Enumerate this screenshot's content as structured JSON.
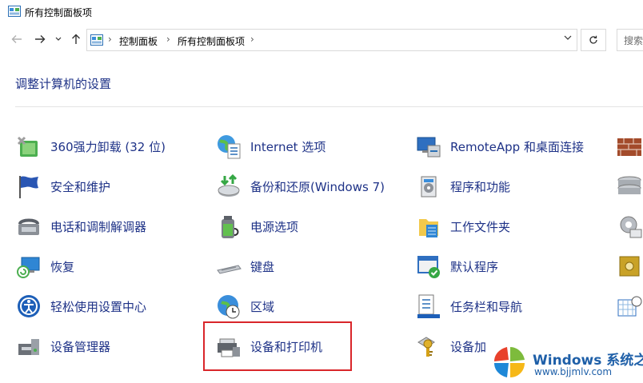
{
  "window": {
    "title": "所有控制面板项"
  },
  "address_bar": {
    "breadcrumbs": [
      "控制面板",
      "所有控制面板项"
    ],
    "search_placeholder": "搜索"
  },
  "heading": "调整计算机的设置",
  "items": [
    {
      "label": "360强力卸载 (32 位)",
      "icon": "uninstall-icon"
    },
    {
      "label": "Internet 选项",
      "icon": "internet-globe-icon"
    },
    {
      "label": "RemoteApp 和桌面连接",
      "icon": "remote-desktop-icon"
    },
    {
      "label": "安全和维护",
      "icon": "security-flag-icon"
    },
    {
      "label": "备份和还原(Windows 7)",
      "icon": "backup-icon"
    },
    {
      "label": "程序和功能",
      "icon": "programs-icon"
    },
    {
      "label": "电话和调制解调器",
      "icon": "phone-modem-icon"
    },
    {
      "label": "电源选项",
      "icon": "power-icon"
    },
    {
      "label": "工作文件夹",
      "icon": "work-folder-icon"
    },
    {
      "label": "恢复",
      "icon": "recovery-icon"
    },
    {
      "label": "键盘",
      "icon": "keyboard-icon"
    },
    {
      "label": "默认程序",
      "icon": "default-programs-icon"
    },
    {
      "label": "轻松使用设置中心",
      "icon": "ease-of-access-icon"
    },
    {
      "label": "区域",
      "icon": "region-clock-icon"
    },
    {
      "label": "任务栏和导航",
      "icon": "taskbar-icon"
    },
    {
      "label": "设备管理器",
      "icon": "device-manager-icon"
    },
    {
      "label": "设备和打印机",
      "icon": "printer-icon"
    },
    {
      "label": "设备加",
      "icon": "device-add-icon"
    }
  ],
  "watermark": {
    "title": "Windows 系统之家",
    "url": "www.bjjmlv.com"
  },
  "colors": {
    "link": "#1e3287",
    "highlight": "#d9262a"
  }
}
